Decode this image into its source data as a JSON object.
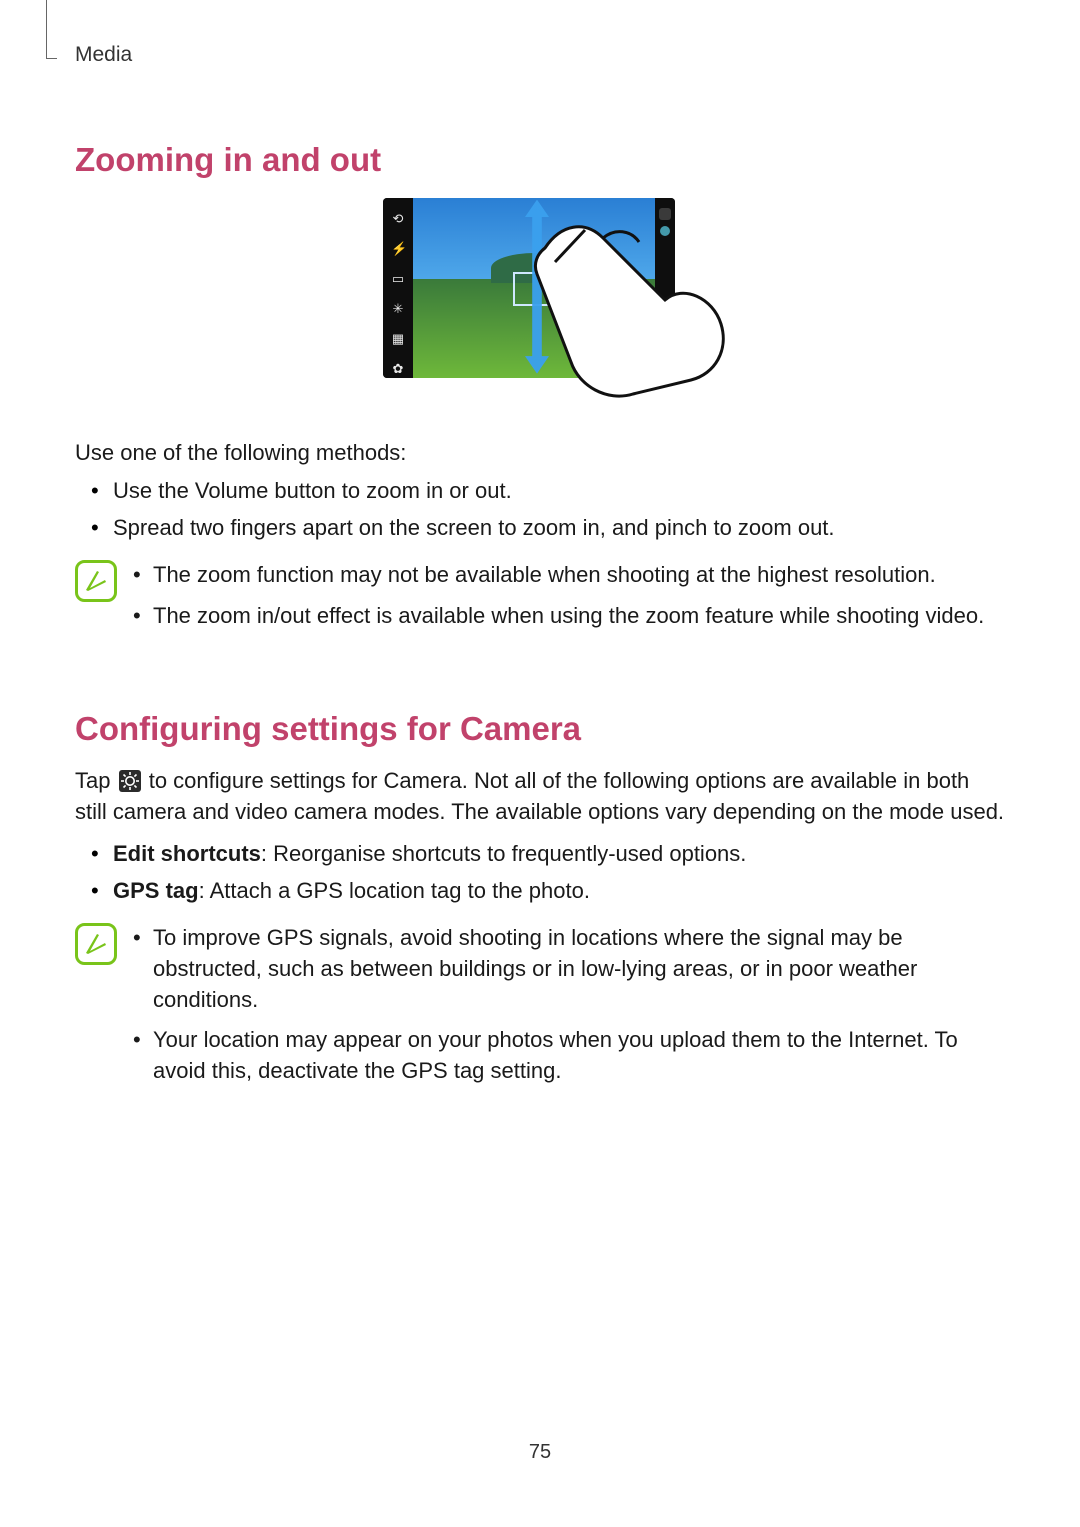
{
  "breadcrumb": "Media",
  "section1": {
    "heading": "Zooming in and out",
    "intro": "Use one of the following methods:",
    "bullets": [
      "Use the Volume button to zoom in or out.",
      "Spread two fingers apart on the screen to zoom in, and pinch to zoom out."
    ],
    "notes": [
      "The zoom function may not be available when shooting at the highest resolution.",
      "The zoom in/out effect is available when using the zoom feature while shooting video."
    ],
    "camera_icons": [
      "switch-camera-icon",
      "flash-icon",
      "aspect-icon",
      "effect-icon",
      "mode-icon",
      "gear-icon"
    ]
  },
  "section2": {
    "heading": "Configuring settings for Camera",
    "intro_prefix": "Tap ",
    "intro_suffix": " to configure settings for Camera. Not all of the following options are available in both still camera and video camera modes. The available options vary depending on the mode used.",
    "bullets": [
      {
        "label": "Edit shortcuts",
        "text": ": Reorganise shortcuts to frequently-used options."
      },
      {
        "label": "GPS tag",
        "text": ": Attach a GPS location tag to the photo."
      }
    ],
    "notes": [
      "To improve GPS signals, avoid shooting in locations where the signal may be obstructed, such as between buildings or in low-lying areas, or in poor weather conditions.",
      "Your location may appear on your photos when you upload them to the Internet. To avoid this, deactivate the GPS tag setting."
    ]
  },
  "page_number": "75"
}
